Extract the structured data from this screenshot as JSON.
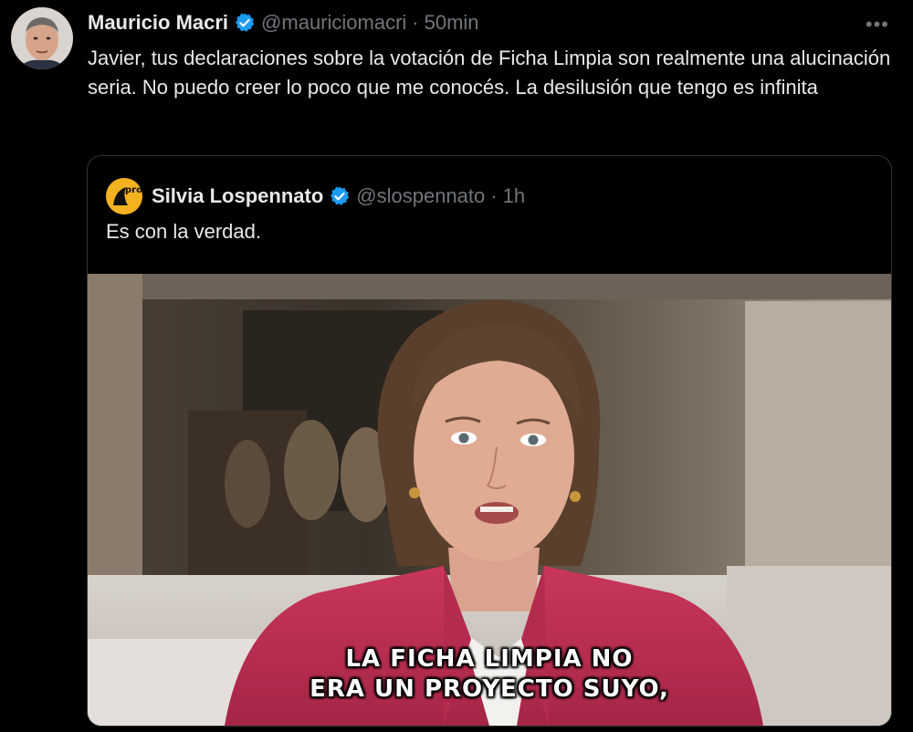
{
  "tweet": {
    "author_name": "Mauricio Macri",
    "handle": "@mauriciomacri",
    "separator": "·",
    "time": "50min",
    "more_icon": "more-horizontal-icon",
    "text": "Javier, tus declaraciones sobre la votación de Ficha Limpia son realmente una alucinación seria. No puedo creer lo poco que me conocés. La desilusión que tengo es infinita"
  },
  "quote": {
    "author_name": "Silvia Lospennato",
    "handle": "@slospennato",
    "separator": "·",
    "time": "1h",
    "avatar_label": "pro",
    "text": "Es con la verdad.",
    "video": {
      "caption_line1": "LA FICHA LIMPIA NO",
      "caption_line2": "ERA UN PROYECTO SUYO,"
    }
  },
  "colors": {
    "background": "#000000",
    "text_primary": "#e7e9ea",
    "text_secondary": "#71767b",
    "verified_blue": "#1d9bf0",
    "border": "#2f3336",
    "quote_avatar": "#f3b21f"
  }
}
